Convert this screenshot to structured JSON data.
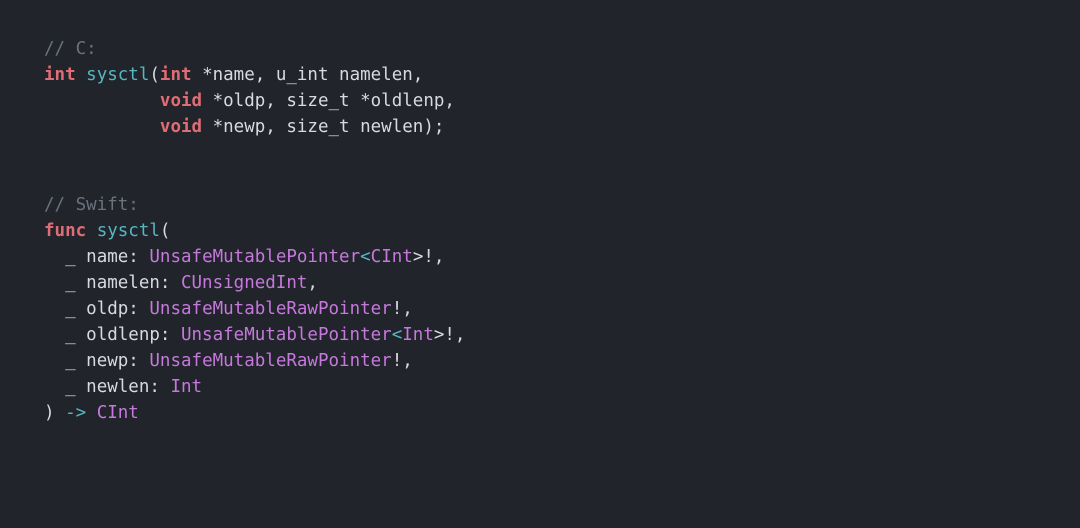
{
  "code": {
    "tokens": [
      [
        {
          "t": "// C:",
          "c": "comment"
        }
      ],
      [
        {
          "t": "int",
          "c": "keyword"
        },
        {
          "t": " ",
          "c": "punct"
        },
        {
          "t": "sysctl",
          "c": "func"
        },
        {
          "t": "(",
          "c": "punct"
        },
        {
          "t": "int",
          "c": "keyword"
        },
        {
          "t": " *name, u_int namelen,",
          "c": "param"
        }
      ],
      [
        {
          "t": "           ",
          "c": "punct"
        },
        {
          "t": "void",
          "c": "keyword"
        },
        {
          "t": " *oldp, size_t *oldlenp,",
          "c": "param"
        }
      ],
      [
        {
          "t": "           ",
          "c": "punct"
        },
        {
          "t": "void",
          "c": "keyword"
        },
        {
          "t": " *newp, size_t newlen);",
          "c": "param"
        }
      ],
      [],
      [],
      [
        {
          "t": "// Swift:",
          "c": "comment"
        }
      ],
      [
        {
          "t": "func",
          "c": "keyword"
        },
        {
          "t": " ",
          "c": "punct"
        },
        {
          "t": "sysctl",
          "c": "func"
        },
        {
          "t": "(",
          "c": "punct"
        }
      ],
      [
        {
          "t": "  ",
          "c": "punct"
        },
        {
          "t": "_",
          "c": "under"
        },
        {
          "t": " name: ",
          "c": "param"
        },
        {
          "t": "UnsafeMutablePointer",
          "c": "type"
        },
        {
          "t": "<",
          "c": "op"
        },
        {
          "t": "CInt",
          "c": "type"
        },
        {
          "t": ">!,",
          "c": "punct"
        }
      ],
      [
        {
          "t": "  ",
          "c": "punct"
        },
        {
          "t": "_",
          "c": "under"
        },
        {
          "t": " namelen: ",
          "c": "param"
        },
        {
          "t": "CUnsignedInt",
          "c": "type"
        },
        {
          "t": ",",
          "c": "punct"
        }
      ],
      [
        {
          "t": "  ",
          "c": "punct"
        },
        {
          "t": "_",
          "c": "under"
        },
        {
          "t": " oldp: ",
          "c": "param"
        },
        {
          "t": "UnsafeMutableRawPointer",
          "c": "type"
        },
        {
          "t": "!,",
          "c": "punct"
        }
      ],
      [
        {
          "t": "  ",
          "c": "punct"
        },
        {
          "t": "_",
          "c": "under"
        },
        {
          "t": " oldlenp: ",
          "c": "param"
        },
        {
          "t": "UnsafeMutablePointer",
          "c": "type"
        },
        {
          "t": "<",
          "c": "op"
        },
        {
          "t": "Int",
          "c": "type"
        },
        {
          "t": ">!,",
          "c": "punct"
        }
      ],
      [
        {
          "t": "  ",
          "c": "punct"
        },
        {
          "t": "_",
          "c": "under"
        },
        {
          "t": " newp: ",
          "c": "param"
        },
        {
          "t": "UnsafeMutableRawPointer",
          "c": "type"
        },
        {
          "t": "!,",
          "c": "punct"
        }
      ],
      [
        {
          "t": "  ",
          "c": "punct"
        },
        {
          "t": "_",
          "c": "under"
        },
        {
          "t": " newlen: ",
          "c": "param"
        },
        {
          "t": "Int",
          "c": "type"
        }
      ],
      [
        {
          "t": ") ",
          "c": "punct"
        },
        {
          "t": "->",
          "c": "op"
        },
        {
          "t": " ",
          "c": "punct"
        },
        {
          "t": "CInt",
          "c": "type"
        }
      ]
    ]
  }
}
